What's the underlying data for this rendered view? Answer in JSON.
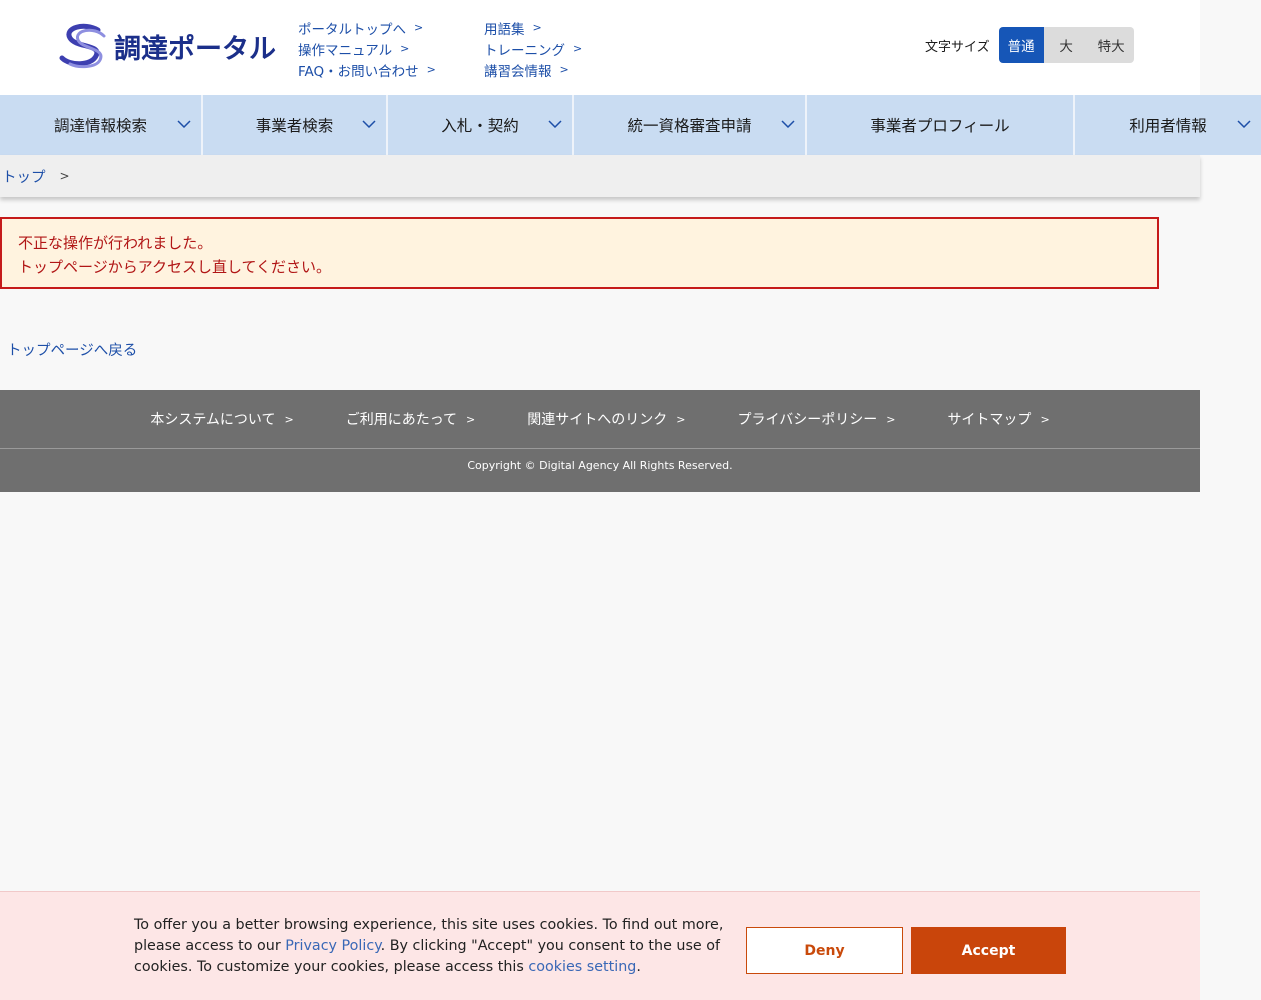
{
  "header": {
    "logo_text": "調達ポータル",
    "links_col1": [
      "ポータルトップへ",
      "操作マニュアル",
      "FAQ・お問い合わせ"
    ],
    "links_col2": [
      "用語集",
      "トレーニング",
      "講習会情報"
    ],
    "font_size": {
      "label": "文字サイズ",
      "options": [
        "普通",
        "大",
        "特大"
      ],
      "selected": "普通"
    }
  },
  "nav": {
    "items": [
      "調達情報検索",
      "事業者検索",
      "入札・契約",
      "統一資格審査申請",
      "事業者プロフィール",
      "利用者情報"
    ]
  },
  "breadcrumb": {
    "items": [
      "トップ"
    ]
  },
  "error": {
    "line1": "不正な操作が行われました。",
    "line2": "トップページからアクセスし直してください。"
  },
  "back_link": "トップページへ戻る",
  "footer": {
    "links": [
      "本システムについて",
      "ご利用にあたって",
      "関連サイトへのリンク",
      "プライバシーポリシー",
      "サイトマップ"
    ],
    "copyright": "Copyright © Digital Agency All Rights Reserved."
  },
  "cookie": {
    "text_before": "To offer you a better browsing experience, this site uses cookies. To find out more, please access to our ",
    "privacy_link": "Privacy Policy",
    "text_middle": ". By clicking \"Accept\" you consent to the use of cookies. To customize your cookies, please access this ",
    "settings_link": "cookies setting",
    "text_after": ".",
    "deny_label": "Deny",
    "accept_label": "Accept"
  },
  "colors": {
    "brand_blue": "#1656b7",
    "nav_bg": "#c9dcf2",
    "error_red": "#c51a1a",
    "accept_orange": "#c9450b"
  }
}
